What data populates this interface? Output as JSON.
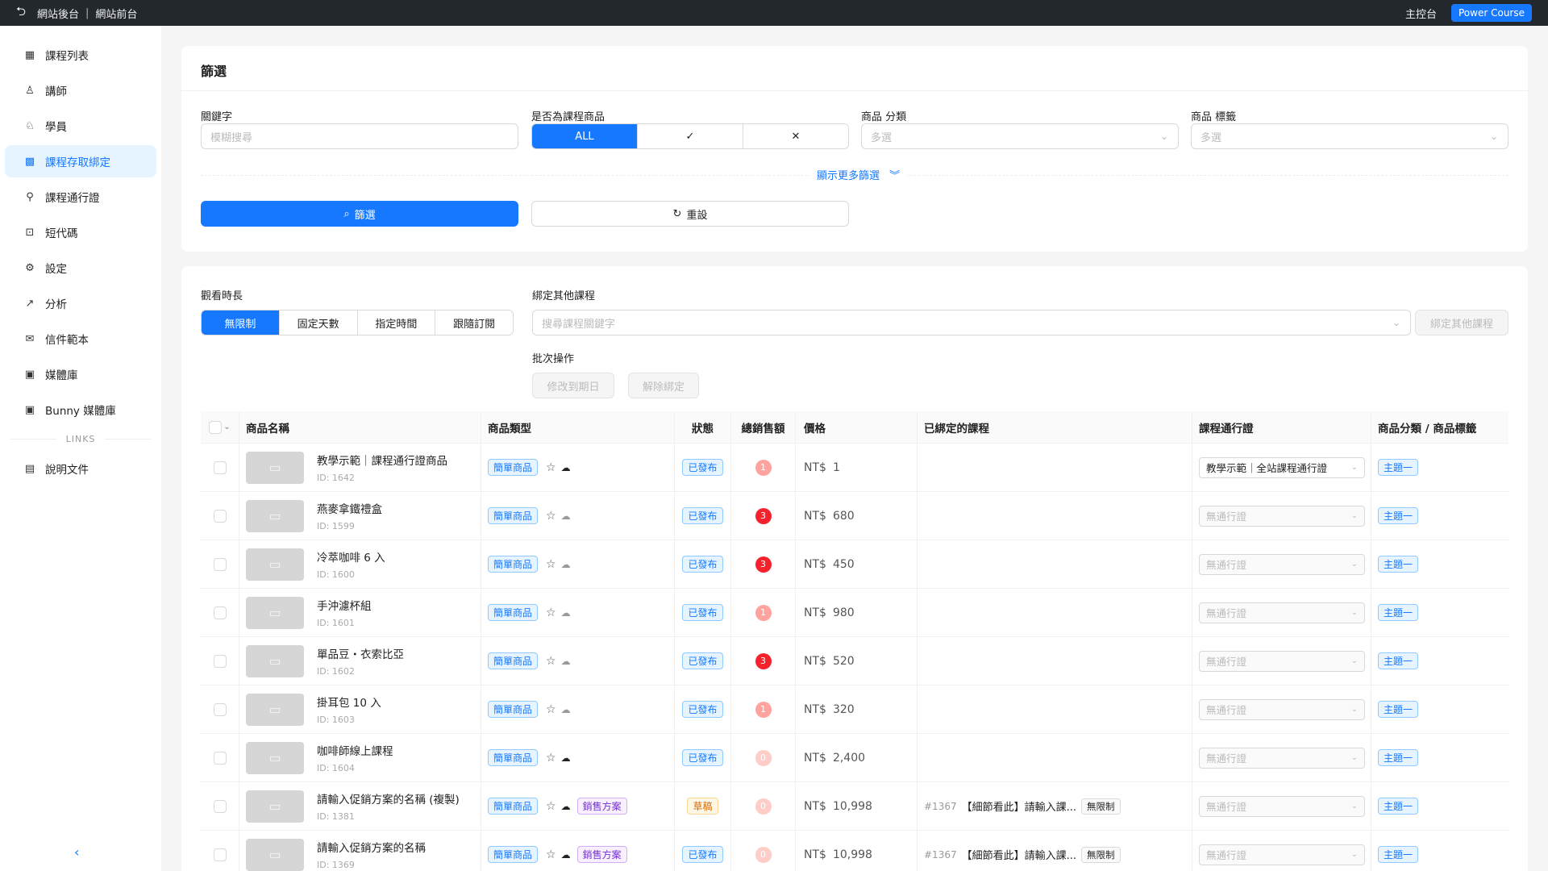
{
  "topbar": {
    "back_admin": "網站後台",
    "front": "網站前台",
    "console": "主控台",
    "brand": "Power Course"
  },
  "sidebar": {
    "items": [
      {
        "label": "課程列表",
        "icon": "table-icon"
      },
      {
        "label": "講師",
        "icon": "user-icon"
      },
      {
        "label": "學員",
        "icon": "users-icon"
      },
      {
        "label": "課程存取綁定",
        "icon": "apps-icon"
      },
      {
        "label": "課程通行證",
        "icon": "key-icon"
      },
      {
        "label": "短代碼",
        "icon": "code-icon"
      },
      {
        "label": "設定",
        "icon": "settings-icon"
      },
      {
        "label": "分析",
        "icon": "chart-icon"
      },
      {
        "label": "信件範本",
        "icon": "mail-icon"
      },
      {
        "label": "媒體庫",
        "icon": "media-icon"
      },
      {
        "label": "Bunny 媒體庫",
        "icon": "media-icon"
      }
    ],
    "links_label": "LINKS",
    "doc_label": "說明文件"
  },
  "filter": {
    "title": "篩選",
    "keyword_label": "關鍵字",
    "keyword_placeholder": "模糊搜尋",
    "is_course_label": "是否為課程商品",
    "is_course_options": [
      "ALL",
      "✓",
      "✕"
    ],
    "category_label": "商品 分類",
    "category_placeholder": "多選",
    "tag_label": "商品 標籤",
    "tag_placeholder": "多選",
    "more_label": "顯示更多篩選",
    "filter_btn": "篩選",
    "reset_btn": "重設"
  },
  "panel": {
    "watch_label": "觀看時長",
    "watch_options": [
      "無限制",
      "固定天數",
      "指定時間",
      "跟隨訂閱"
    ],
    "bind_label": "綁定其他課程",
    "bind_placeholder": "搜尋課程關鍵字",
    "bind_btn": "綁定其他課程",
    "batch_label": "批次操作",
    "batch_change": "修改到期日",
    "batch_unbind": "解除綁定"
  },
  "table": {
    "headers": [
      "商品名稱",
      "商品類型",
      "狀態",
      "總銷售額",
      "價格",
      "已綁定的課程",
      "課程通行證",
      "商品分類 / 商品標籤"
    ],
    "rows": [
      {
        "name": "教學示範｜課程通行證商品",
        "id": "ID: 1642",
        "type": "簡單商品",
        "extra_tag": "",
        "cloud": "solid",
        "status": "已發布",
        "sales": "1",
        "currency": "NT$",
        "price": "1",
        "bound_id": "",
        "bound_name": "",
        "bound_limit": "",
        "pass": "教學示範｜全站課程通行證",
        "category": "主題一"
      },
      {
        "name": "燕麥拿鐵禮盒",
        "id": "ID: 1599",
        "type": "簡單商品",
        "extra_tag": "",
        "cloud": "outline",
        "status": "已發布",
        "sales": "3",
        "currency": "NT$",
        "price": "680",
        "bound_id": "",
        "bound_name": "",
        "bound_limit": "",
        "pass": "無通行證",
        "category": "主題一"
      },
      {
        "name": "冷萃咖啡 6 入",
        "id": "ID: 1600",
        "type": "簡單商品",
        "extra_tag": "",
        "cloud": "outline",
        "status": "已發布",
        "sales": "3",
        "currency": "NT$",
        "price": "450",
        "bound_id": "",
        "bound_name": "",
        "bound_limit": "",
        "pass": "無通行證",
        "category": "主題一"
      },
      {
        "name": "手沖濾杯組",
        "id": "ID: 1601",
        "type": "簡單商品",
        "extra_tag": "",
        "cloud": "outline",
        "status": "已發布",
        "sales": "1",
        "currency": "NT$",
        "price": "980",
        "bound_id": "",
        "bound_name": "",
        "bound_limit": "",
        "pass": "無通行證",
        "category": "主題一"
      },
      {
        "name": "單品豆・衣索比亞",
        "id": "ID: 1602",
        "type": "簡單商品",
        "extra_tag": "",
        "cloud": "outline",
        "status": "已發布",
        "sales": "3",
        "currency": "NT$",
        "price": "520",
        "bound_id": "",
        "bound_name": "",
        "bound_limit": "",
        "pass": "無通行證",
        "category": "主題一"
      },
      {
        "name": "掛耳包 10 入",
        "id": "ID: 1603",
        "type": "簡單商品",
        "extra_tag": "",
        "cloud": "outline",
        "status": "已發布",
        "sales": "1",
        "currency": "NT$",
        "price": "320",
        "bound_id": "",
        "bound_name": "",
        "bound_limit": "",
        "pass": "無通行證",
        "category": "主題一"
      },
      {
        "name": "咖啡師線上課程",
        "id": "ID: 1604",
        "type": "簡單商品",
        "extra_tag": "",
        "cloud": "solid",
        "status": "已發布",
        "sales": "0",
        "currency": "NT$",
        "price": "2,400",
        "bound_id": "",
        "bound_name": "",
        "bound_limit": "",
        "pass": "無通行證",
        "category": "主題一"
      },
      {
        "name": "請輸入促銷方案的名稱 (複製)",
        "id": "ID: 1381",
        "type": "簡單商品",
        "extra_tag": "銷售方案",
        "cloud": "solid",
        "status": "草稿",
        "sales": "0",
        "currency": "NT$",
        "price": "10,998",
        "bound_id": "#1367",
        "bound_name": "【細節看此】請輸入課...",
        "bound_limit": "無限制",
        "pass": "無通行證",
        "category": "主題一"
      },
      {
        "name": "請輸入促銷方案的名稱",
        "id": "ID: 1369",
        "type": "簡單商品",
        "extra_tag": "銷售方案",
        "cloud": "solid",
        "status": "已發布",
        "sales": "0",
        "currency": "NT$",
        "price": "10,998",
        "bound_id": "#1367",
        "bound_name": "【細節看此】請輸入課...",
        "bound_limit": "無限制",
        "pass": "無通行證",
        "category": "主題一"
      }
    ]
  }
}
